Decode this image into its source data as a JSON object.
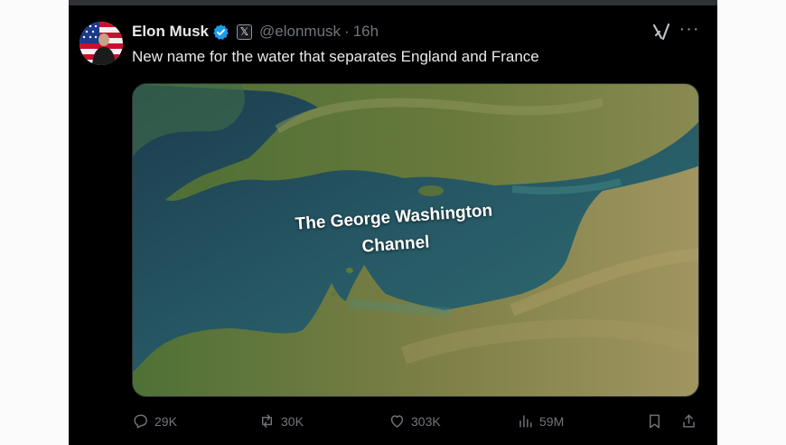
{
  "tweet": {
    "author_name": "Elon Musk",
    "handle": "@elonmusk",
    "separator": "·",
    "time": "16h",
    "affiliate_badge": "𝕏",
    "text": "New name for the water that separates England and France",
    "image_caption_line1": "The George Washington",
    "image_caption_line2": "Channel",
    "more_label": "···"
  },
  "stats": {
    "replies": "29K",
    "reposts": "30K",
    "likes": "303K",
    "views": "59M"
  },
  "icons": {
    "verified": "verified-badge-icon",
    "affiliate": "x-logo-icon",
    "grok": "grok-icon",
    "more": "more-icon",
    "reply": "reply-icon",
    "repost": "repost-icon",
    "like": "heart-icon",
    "views": "views-icon",
    "bookmark": "bookmark-icon",
    "share": "share-icon"
  },
  "colors": {
    "background": "#000000",
    "text": "#e7e9ea",
    "secondary": "#71767b",
    "verified": "#1d9bf0"
  }
}
